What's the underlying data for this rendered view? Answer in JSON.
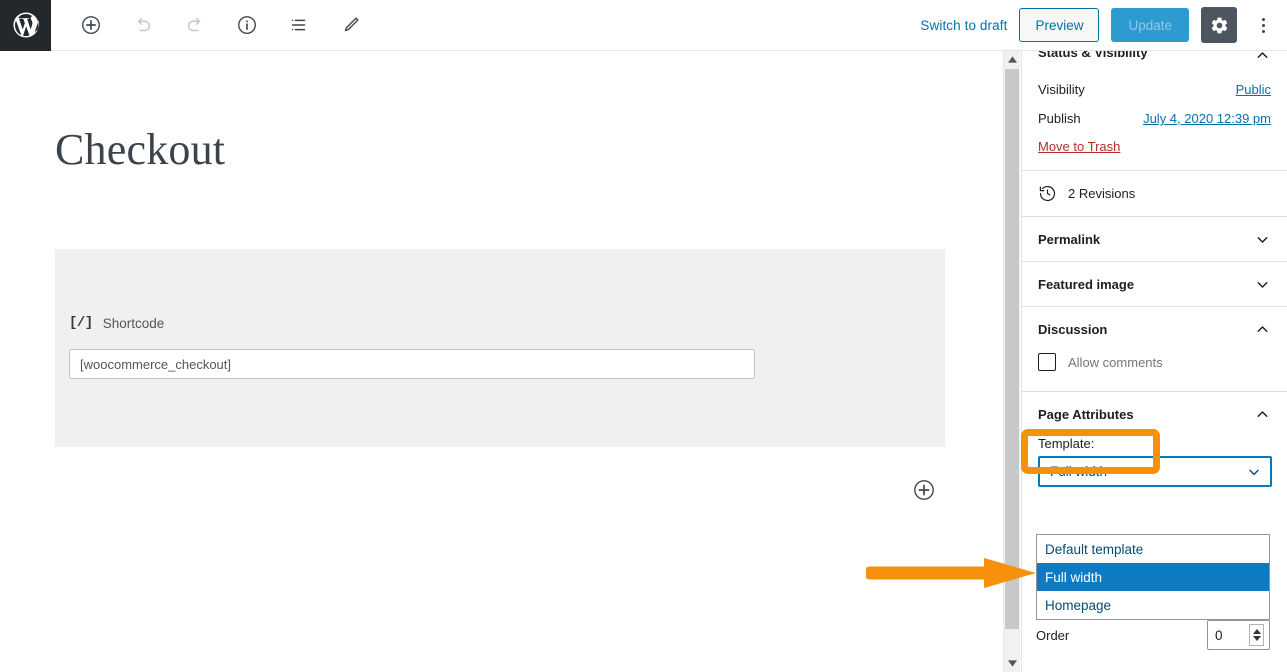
{
  "topbar": {
    "logo_icon": "wordpress-logo",
    "tools": [
      {
        "name": "add-block-icon",
        "label": "Add block",
        "disabled": false
      },
      {
        "name": "undo-icon",
        "label": "Undo",
        "disabled": true
      },
      {
        "name": "redo-icon",
        "label": "Redo",
        "disabled": true
      },
      {
        "name": "info-icon",
        "label": "Details",
        "disabled": false
      },
      {
        "name": "list-view-icon",
        "label": "List view",
        "disabled": false
      },
      {
        "name": "edit-pencil-icon",
        "label": "Edit",
        "disabled": false
      }
    ],
    "switch_to_draft": "Switch to draft",
    "preview": "Preview",
    "update": "Update",
    "settings_icon": "gear-icon",
    "more_icon": "kebab-menu-icon"
  },
  "editor": {
    "title": "Checkout",
    "block": {
      "icon": "[/]",
      "label": "Shortcode",
      "value": "[woocommerce_checkout]"
    },
    "add_block_icon": "plus-circle-icon"
  },
  "sidebar": {
    "status": {
      "title": "Status & Visibility",
      "visibility_label": "Visibility",
      "visibility_value": "Public",
      "publish_label": "Publish",
      "publish_value": "July 4, 2020 12:39 pm",
      "trash": "Move to Trash"
    },
    "revisions": {
      "icon": "clock-revision-icon",
      "label": "2 Revisions"
    },
    "permalink": {
      "title": "Permalink",
      "collapsed": true
    },
    "featured_image": {
      "title": "Featured image",
      "collapsed": true
    },
    "discussion": {
      "title": "Discussion",
      "allow_comments_label": "Allow comments",
      "allow_comments_checked": false
    },
    "page_attributes": {
      "title": "Page Attributes",
      "template_label": "Template:",
      "template_value": "Full width",
      "template_options": [
        "Default template",
        "Full width",
        "Homepage"
      ],
      "template_selected_index": 1,
      "order_label": "Order",
      "order_value": "0"
    }
  },
  "annotations": {
    "highlight_color": "#f7900a",
    "highlight_target": "Page Attributes",
    "arrow_color": "#f7900a",
    "arrow_points_to": "Full width"
  }
}
